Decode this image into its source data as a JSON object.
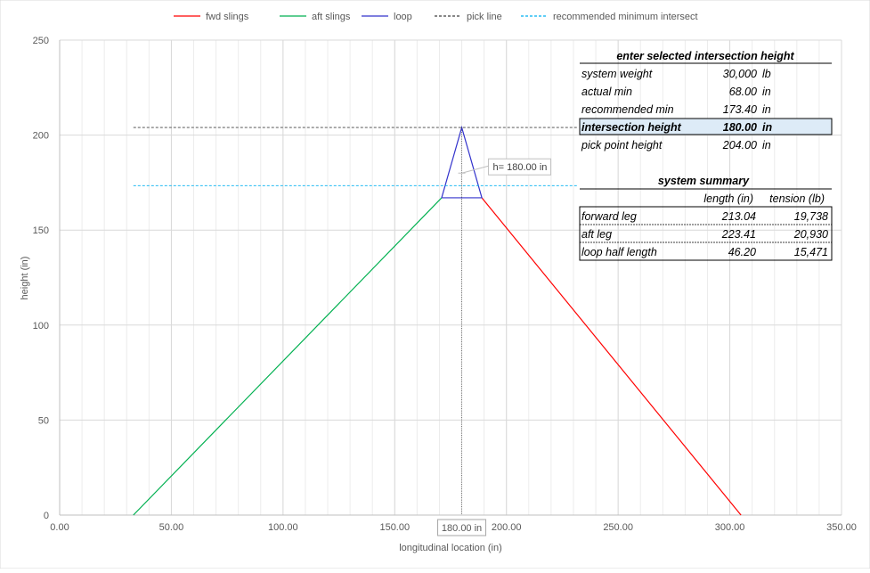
{
  "chart_data": {
    "type": "line",
    "xlabel": "longitudinal location (in)",
    "ylabel": "height (in)",
    "xlim": [
      0,
      350
    ],
    "ylim": [
      0,
      250
    ],
    "x_ticks": [
      "0.00",
      "50.00",
      "100.00",
      "150.00",
      "200.00",
      "250.00",
      "300.00",
      "350.00"
    ],
    "x_tick_values": [
      0,
      50,
      100,
      150,
      200,
      250,
      300,
      350
    ],
    "y_ticks": [
      "0",
      "50",
      "100",
      "150",
      "200",
      "250"
    ],
    "y_tick_values": [
      0,
      50,
      100,
      150,
      200,
      250
    ],
    "x_minor_grid_step": 10,
    "grid": true,
    "legend_position": "top",
    "series": [
      {
        "name": "fwd slings",
        "color": "#ff0000",
        "dash": "solid",
        "x": [
          305,
          189
        ],
        "y": [
          0,
          167
        ]
      },
      {
        "name": "aft slings",
        "color": "#00b050",
        "dash": "solid",
        "x": [
          33,
          171
        ],
        "y": [
          0,
          167
        ]
      },
      {
        "name": "loop",
        "color": "#3333cc",
        "dash": "solid",
        "x": [
          171,
          189,
          180,
          171
        ],
        "y": [
          167,
          167,
          204,
          167
        ]
      },
      {
        "name": "pick line",
        "color": "#404040",
        "dash": "dashed",
        "x": [
          33,
          232
        ],
        "y": [
          204,
          204
        ]
      },
      {
        "name": "recommended minimum intersect",
        "color": "#00b0f0",
        "dash": "dashed",
        "x": [
          33,
          232
        ],
        "y": [
          173.4,
          173.4
        ]
      }
    ],
    "vertical_marker": {
      "x": 180,
      "label": "180.00 in",
      "color": "#404040"
    },
    "height_marker": {
      "x": 180,
      "y": 180,
      "label": "h= 180.00 in"
    }
  },
  "input_table": {
    "title": "enter selected intersection height",
    "rows": [
      {
        "label": "system weight",
        "value": "30,000",
        "unit": "lb"
      },
      {
        "label": "actual min",
        "value": "68.00",
        "unit": "in"
      },
      {
        "label": "recommended min",
        "value": "173.40",
        "unit": "in"
      },
      {
        "label": "intersection height",
        "value": "180.00",
        "unit": "in"
      },
      {
        "label": "pick point height",
        "value": "204.00",
        "unit": "in"
      }
    ]
  },
  "summary_table": {
    "title": "system summary",
    "col_length": "length (in)",
    "col_tension": "tension (lb)",
    "rows": [
      {
        "label": "forward leg",
        "length": "213.04",
        "tension": "19,738"
      },
      {
        "label": "aft leg",
        "length": "223.41",
        "tension": "20,930"
      },
      {
        "label": "loop half length",
        "length": "46.20",
        "tension": "15,471"
      }
    ]
  },
  "colors": {
    "highlight_cell": "#ddebf7",
    "grid": "#d9d9d9",
    "axis": "#bfbfbf"
  }
}
